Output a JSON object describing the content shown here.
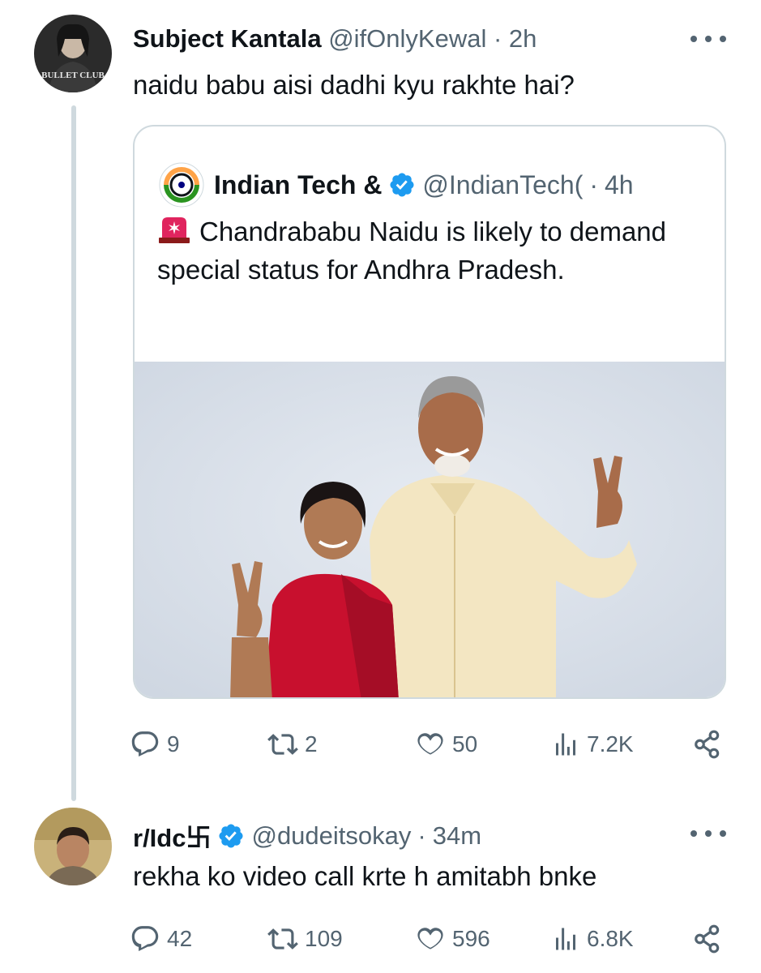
{
  "tweet1": {
    "display_name": "Subject Kantala",
    "handle": "@ifOnlyKewal",
    "separator": "·",
    "time": "2h",
    "text": "naidu babu aisi dadhi kyu rakhte hai?",
    "avatar_badge": "BULLET CLUB"
  },
  "quote": {
    "display_name": "Indian Tech &",
    "handle": "@IndianTech(",
    "separator": "·",
    "time": "4h",
    "text": "Chandrababu Naidu is likely to demand special status for Andhra Pradesh."
  },
  "tweet1_actions": {
    "replies": "9",
    "retweets": "2",
    "likes": "50",
    "views": "7.2K"
  },
  "tweet2": {
    "display_name": "r/Idc卐",
    "handle": "@dudeitsokay",
    "separator": "·",
    "time": "34m",
    "text": "rekha ko video call krte h amitabh bnke"
  },
  "tweet2_actions": {
    "replies": "42",
    "retweets": "109",
    "likes": "596",
    "views": "6.8K"
  },
  "colors": {
    "text_primary": "#0f1419",
    "text_secondary": "#536471",
    "border": "#cfd9de",
    "verified_blue": "#1d9bf0",
    "saree_red": "#c8102e",
    "kurta_cream": "#f3e6c2",
    "photo_backdrop": "#dfe5ee"
  },
  "icons": [
    "more-icon",
    "verified-icon",
    "siren-icon",
    "reply-icon",
    "retweet-icon",
    "like-icon",
    "views-icon",
    "share-icon"
  ]
}
